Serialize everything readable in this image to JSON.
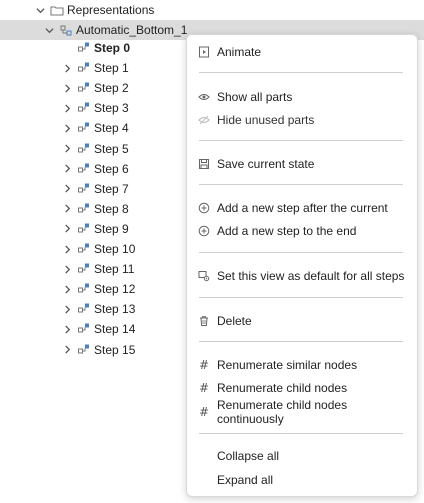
{
  "tree": {
    "root": {
      "label": "Representations",
      "icon": "folder-icon"
    },
    "child": {
      "label": "Automatic_Bottom_1",
      "icon": "structure-icon"
    },
    "steps": [
      {
        "label": "Step 0"
      },
      {
        "label": "Step 1"
      },
      {
        "label": "Step 2"
      },
      {
        "label": "Step 3"
      },
      {
        "label": "Step 4"
      },
      {
        "label": "Step 5"
      },
      {
        "label": "Step 6"
      },
      {
        "label": "Step 7"
      },
      {
        "label": "Step 8"
      },
      {
        "label": "Step 9"
      },
      {
        "label": "Step 10"
      },
      {
        "label": "Step 11"
      },
      {
        "label": "Step 12"
      },
      {
        "label": "Step 13"
      },
      {
        "label": "Step 14"
      },
      {
        "label": "Step 15"
      }
    ]
  },
  "menu": {
    "animate": "Animate",
    "show_all_parts": "Show all parts",
    "hide_unused_parts": "Hide unused parts",
    "save_current_state": "Save current state",
    "add_step_after": "Add a new step after the current",
    "add_step_end": "Add a new step to the end",
    "set_default_view": "Set this view as default for all steps",
    "delete": "Delete",
    "renumerate_similar": "Renumerate similar nodes",
    "renumerate_child": "Renumerate child nodes",
    "renumerate_continuously": "Renumerate child nodes continuously",
    "collapse_all": "Collapse all",
    "expand_all": "Expand all",
    "hash_symbol": "#"
  },
  "colors": {
    "selected_row": "#dcdcdc",
    "icon_blue": "#4a7fc1",
    "menu_border": "#d9d9d9"
  }
}
